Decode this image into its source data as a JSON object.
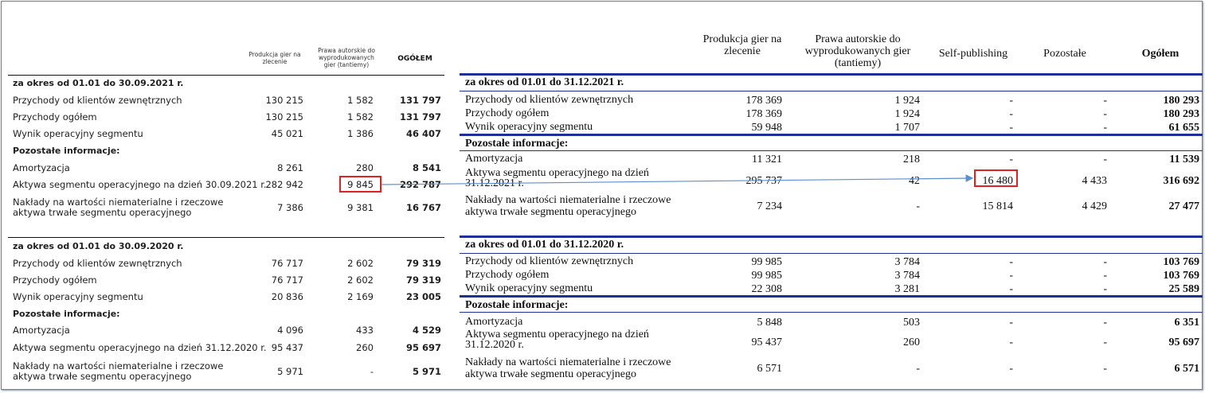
{
  "left": {
    "headers": {
      "col1": "Produkcja gier na zlecenie",
      "col2": "Prawa autorskie do wyprodukowanych gier (tantiemy)",
      "col3": "OGÓŁEM"
    },
    "section1": {
      "title": "za okres od 01.01 do 30.09.2021 r.",
      "rows": [
        {
          "label": "Przychody od klientów zewnętrznych",
          "c1": "130 215",
          "c2": "1 582",
          "c3": "131 797"
        },
        {
          "label": "Przychody ogółem",
          "c1": "130 215",
          "c2": "1 582",
          "c3": "131 797"
        },
        {
          "label": "Wynik operacyjny segmentu",
          "c1": "45 021",
          "c2": "1 386",
          "c3": "46 407"
        }
      ],
      "other_title": "Pozostałe informacje:",
      "other_rows": [
        {
          "label": "Amortyzacja",
          "c1": "8 261",
          "c2": "280",
          "c3": "8 541"
        },
        {
          "label": "Aktywa segmentu operacyjnego na dzień 30.09.2021 r.",
          "c1": "282 942",
          "c2": "9 845",
          "c3": "292 787"
        },
        {
          "label": "Nakłady na wartości niematerialne i rzeczowe aktywa trwałe segmentu operacyjnego",
          "c1": "7 386",
          "c2": "9 381",
          "c3": "16 767"
        }
      ]
    },
    "section2": {
      "title": "za okres od 01.01 do 30.09.2020 r.",
      "rows": [
        {
          "label": "Przychody od klientów zewnętrznych",
          "c1": "76 717",
          "c2": "2 602",
          "c3": "79 319"
        },
        {
          "label": "Przychody ogółem",
          "c1": "76 717",
          "c2": "2 602",
          "c3": "79 319"
        },
        {
          "label": "Wynik operacyjny segmentu",
          "c1": "20 836",
          "c2": "2 169",
          "c3": "23 005"
        }
      ],
      "other_title": "Pozostałe informacje:",
      "other_rows": [
        {
          "label": "Amortyzacja",
          "c1": "4 096",
          "c2": "433",
          "c3": "4 529"
        },
        {
          "label": "Aktywa segmentu operacyjnego na dzień 31.12.2020 r.",
          "c1": "95 437",
          "c2": "260",
          "c3": "95 697"
        },
        {
          "label": "Nakłady na wartości niematerialne i rzeczowe aktywa trwałe segmentu operacyjnego",
          "c1": "5 971",
          "c2": "-",
          "c3": "5 971"
        }
      ]
    }
  },
  "right": {
    "headers": {
      "col1": "Produkcja gier na zlecenie",
      "col2": "Prawa autorskie do wyprodukowanych gier (tantiemy)",
      "col3": "Self-publishing",
      "col4": "Pozostałe",
      "col5": "Ogółem"
    },
    "section1": {
      "title": "za okres od 01.01 do 31.12.2021 r.",
      "rows": [
        {
          "label": "Przychody od klientów zewnętrznych",
          "c1": "178 369",
          "c2": "1 924",
          "c3": "-",
          "c4": "-",
          "c5": "180 293"
        },
        {
          "label": "Przychody ogółem",
          "c1": "178 369",
          "c2": "1 924",
          "c3": "-",
          "c4": "-",
          "c5": "180 293"
        },
        {
          "label": "Wynik operacyjny segmentu",
          "c1": "59 948",
          "c2": "1 707",
          "c3": "-",
          "c4": "-",
          "c5": "61 655"
        }
      ],
      "other_title": "Pozostałe informacje:",
      "other_rows": [
        {
          "label": "Amortyzacja",
          "c1": "11 321",
          "c2": "218",
          "c3": "-",
          "c4": "-",
          "c5": "11 539"
        },
        {
          "label": "Aktywa segmentu operacyjnego na dzień 31.12.2021 r.",
          "c1": "295 737",
          "c2": "42",
          "c3": "16 480",
          "c4": "4 433",
          "c5": "316 692"
        },
        {
          "label": "Nakłady na wartości niematerialne i rzeczowe aktywa trwałe segmentu operacyjnego",
          "c1": "7 234",
          "c2": "-",
          "c3": "15 814",
          "c4": "4 429",
          "c5": "27 477"
        }
      ]
    },
    "section2": {
      "title": "za okres od 01.01 do 31.12.2020 r.",
      "rows": [
        {
          "label": "Przychody od klientów zewnętrznych",
          "c1": "99 985",
          "c2": "3 784",
          "c3": "-",
          "c4": "-",
          "c5": "103 769"
        },
        {
          "label": "Przychody ogółem",
          "c1": "99 985",
          "c2": "3 784",
          "c3": "-",
          "c4": "-",
          "c5": "103 769"
        },
        {
          "label": "Wynik operacyjny segmentu",
          "c1": "22 308",
          "c2": "3 281",
          "c3": "-",
          "c4": "-",
          "c5": "25 589"
        }
      ],
      "other_title": "Pozostałe informacje:",
      "other_rows": [
        {
          "label": "Amortyzacja",
          "c1": "5 848",
          "c2": "503",
          "c3": "-",
          "c4": "-",
          "c5": "6 351"
        },
        {
          "label": "Aktywa segmentu operacyjnego na dzień 31.12.2020 r.",
          "c1": "95 437",
          "c2": "260",
          "c3": "-",
          "c4": "-",
          "c5": "95 697"
        },
        {
          "label": "Nakłady na wartości niematerialne i rzeczowe aktywa trwałe segmentu operacyjnego",
          "c1": "6 571",
          "c2": "-",
          "c3": "-",
          "c4": "-",
          "c5": "6 571"
        }
      ]
    }
  },
  "colors": {
    "highlight_box": "#dd2222",
    "arrow": "#5b8fd0",
    "rule_blue": "#1f2f9a",
    "frame": "#5a7fb0"
  }
}
